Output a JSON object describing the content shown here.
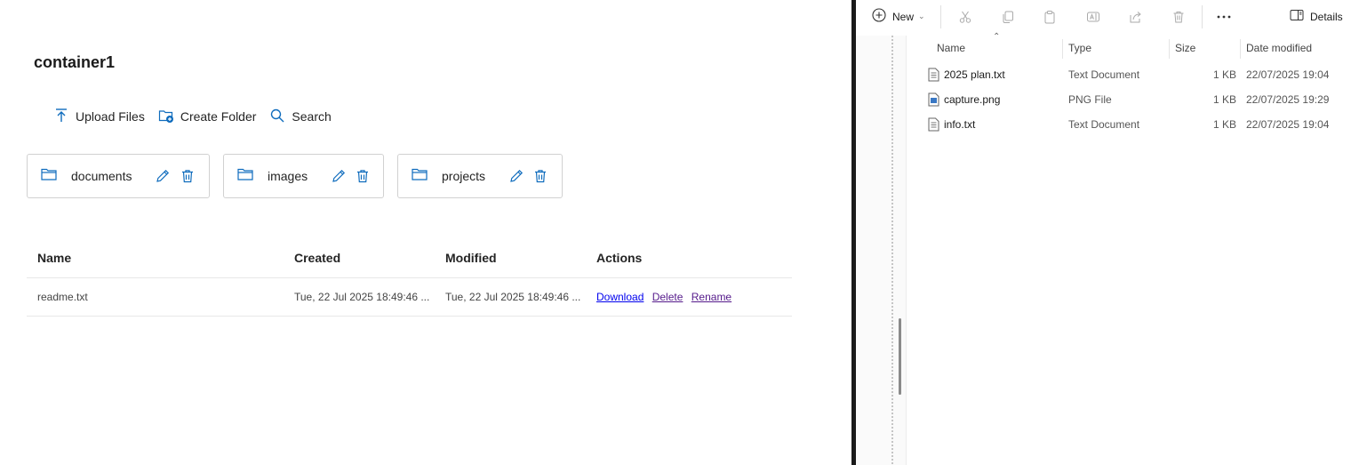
{
  "webapp": {
    "container_title": "container1",
    "toolbar": {
      "upload_label": "Upload Files",
      "create_folder_label": "Create Folder",
      "search_label": "Search"
    },
    "folders": [
      {
        "name": "documents"
      },
      {
        "name": "images"
      },
      {
        "name": "projects"
      }
    ],
    "table": {
      "headers": [
        "Name",
        "Created",
        "Modified",
        "Actions"
      ],
      "rows": [
        {
          "name": "readme.txt",
          "created": "Tue, 22 Jul 2025 18:49:46 ...",
          "modified": "Tue, 22 Jul 2025 18:49:46 ...",
          "actions": [
            "Download",
            "Delete",
            "Rename"
          ]
        }
      ]
    },
    "accent_color": "#0f6cbd"
  },
  "explorer": {
    "new_label": "New",
    "details_label": "Details",
    "columns": [
      "Name",
      "Type",
      "Size",
      "Date modified"
    ],
    "files": [
      {
        "name": "2025 plan.txt",
        "type": "Text Document",
        "size": "1 KB",
        "date": "22/07/2025 19:04",
        "icon": "text-file-icon"
      },
      {
        "name": "capture.png",
        "type": "PNG File",
        "size": "1 KB",
        "date": "22/07/2025 19:29",
        "icon": "image-file-icon"
      },
      {
        "name": "info.txt",
        "type": "Text Document",
        "size": "1 KB",
        "date": "22/07/2025 19:04",
        "icon": "text-file-icon"
      }
    ]
  }
}
